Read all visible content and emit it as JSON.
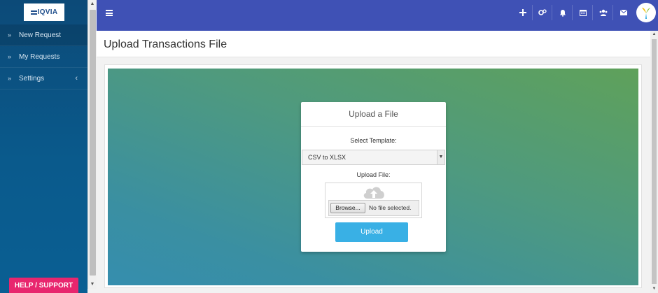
{
  "brand": {
    "logo_text": "IQVIA"
  },
  "sidebar": {
    "items": [
      {
        "label": "New Request",
        "icon": "double-chevron-right-icon"
      },
      {
        "label": "My Requests",
        "icon": "double-chevron-right-icon"
      },
      {
        "label": "Settings",
        "icon": "double-chevron-right-icon",
        "expand_icon": "chevron-left-icon"
      }
    ],
    "help_label": "HELP / SUPPORT"
  },
  "topbar": {
    "menu_icon": "list-icon",
    "icons": [
      "plus-icon",
      "gears-icon",
      "bell-icon",
      "calendar-icon",
      "users-icon",
      "envelope-icon"
    ]
  },
  "page": {
    "title": "Upload Transactions File"
  },
  "upload_card": {
    "header": "Upload a File",
    "template_label": "Select Template:",
    "template_selected": "CSV to XLSX",
    "file_label": "Upload File:",
    "browse_label": "Browse...",
    "file_status": "No file selected.",
    "upload_label": "Upload"
  },
  "colors": {
    "topbar": "#3f51b5",
    "sidebar": "#0a5a8c",
    "help_button": "#e8266e",
    "upload_button": "#39b0e5"
  }
}
